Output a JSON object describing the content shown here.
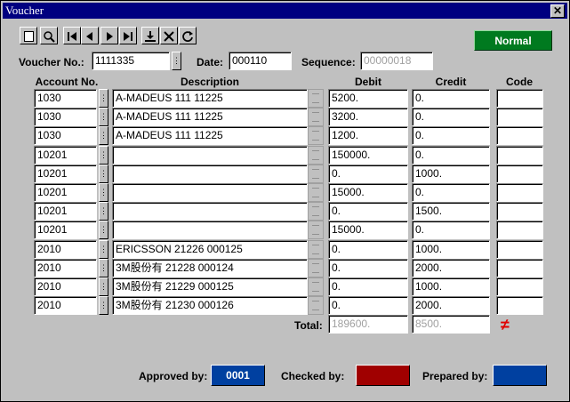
{
  "window": {
    "title": "Voucher",
    "close_label": "✕"
  },
  "toolbar": {
    "buttons": [
      "new",
      "find",
      "first",
      "prev",
      "next",
      "last",
      "save",
      "delete",
      "refresh"
    ]
  },
  "status_button": {
    "label": "Normal",
    "color": "#007a1f"
  },
  "header": {
    "voucher_no_label": "Voucher No.:",
    "voucher_no": "1111335",
    "date_label": "Date:",
    "date": "000110",
    "sequence_label": "Sequence:",
    "sequence": "00000018"
  },
  "columns": {
    "account": "Account No.",
    "description": "Description",
    "debit": "Debit",
    "credit": "Credit",
    "code": "Code"
  },
  "rows": [
    {
      "account": "1030",
      "description": "A-MADEUS 111          11225",
      "debit": "5200.",
      "credit": "0.",
      "code": ""
    },
    {
      "account": "1030",
      "description": "A-MADEUS 111          11225",
      "debit": "3200.",
      "credit": "0.",
      "code": ""
    },
    {
      "account": "1030",
      "description": "A-MADEUS 111          11225",
      "debit": "1200.",
      "credit": "0.",
      "code": ""
    },
    {
      "account": "10201",
      "description": "",
      "debit": "150000.",
      "credit": "0.",
      "code": ""
    },
    {
      "account": "10201",
      "description": "",
      "debit": "0.",
      "credit": "1000.",
      "code": ""
    },
    {
      "account": "10201",
      "description": "",
      "debit": "15000.",
      "credit": "0.",
      "code": ""
    },
    {
      "account": "10201",
      "description": "",
      "debit": "0.",
      "credit": "1500.",
      "code": ""
    },
    {
      "account": "10201",
      "description": "",
      "debit": "15000.",
      "credit": "0.",
      "code": ""
    },
    {
      "account": "2010",
      "description": "ERICSSON 21226 000125",
      "debit": "0.",
      "credit": "1000.",
      "code": ""
    },
    {
      "account": "2010",
      "description": "3M股份有 21228      000124",
      "debit": "0.",
      "credit": "2000.",
      "code": ""
    },
    {
      "account": "2010",
      "description": "3M股份有 21229      000125",
      "debit": "0.",
      "credit": "1000.",
      "code": ""
    },
    {
      "account": "2010",
      "description": "3M股份有 21230      000126",
      "debit": "0.",
      "credit": "2000.",
      "code": ""
    }
  ],
  "totals": {
    "label": "Total:",
    "debit": "189600.",
    "credit": "8500.",
    "mismatch_symbol": "≠",
    "mismatch_color": "#e00000"
  },
  "signoff": {
    "approved_label": "Approved by:",
    "approved_value": "0001",
    "approved_color": "#0040a0",
    "checked_label": "Checked by:",
    "checked_value": "",
    "checked_color": "#a00000",
    "prepared_label": "Prepared by:",
    "prepared_value": "",
    "prepared_color": "#0040a0"
  }
}
